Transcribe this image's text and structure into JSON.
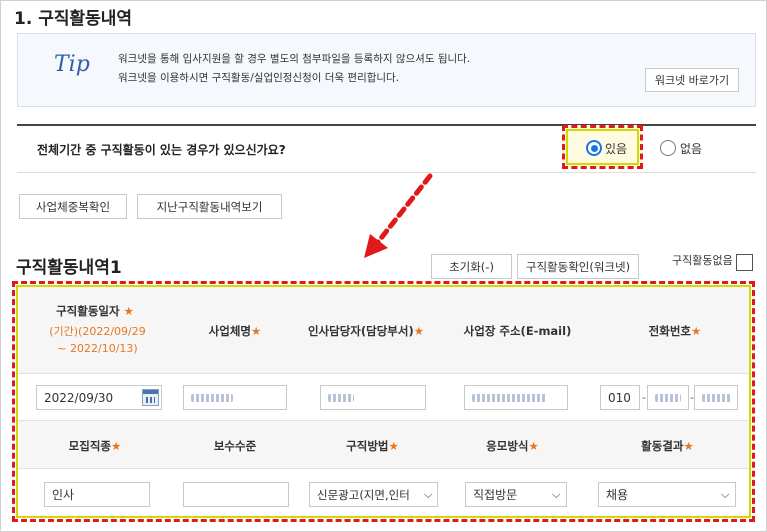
{
  "section": {
    "title": "1. 구직활동내역"
  },
  "tip": {
    "label": "Tip",
    "line1": "워크넷을 통해 입사지원을 할 경우 별도의 첨부파일을 등록하지 않으셔도 됩니다.",
    "line2": "워크넷을 이용하시면 구직활동/실업인정신청이 더욱 편리합니다.",
    "shortcut_button": "워크넷 바로가기"
  },
  "question": {
    "text": "전체기간 중 구직활동이 있는 경우가 있으신가요?",
    "options": [
      {
        "label": "있음",
        "selected": true
      },
      {
        "label": "없음",
        "selected": false
      }
    ]
  },
  "actions": {
    "duplicate_check": "사업체중복확인",
    "past_history": "지난구직활동내역보기"
  },
  "list": {
    "title": "구직활동내역1",
    "reset_button": "초기화(-)",
    "confirm_button": "구직활동확인(워크넷)",
    "no_activity_label": "구직활동없음",
    "no_activity_checked": false
  },
  "table": {
    "header1": {
      "date": "구직활동일자",
      "period": "(기간)(2022/09/29",
      "period2": "~ 2022/10/13)",
      "company": "사업체명",
      "manager": "인사담당자(담당부서)",
      "address": "사업장 주소(E-mail)",
      "phone": "전화번호"
    },
    "row1": {
      "date": "2022/09/30",
      "phone_prefix": "010"
    },
    "header2": {
      "job": "모집직종",
      "salary": "보수수준",
      "method": "구직방법",
      "apply": "응모방식",
      "result": "활동결과"
    },
    "row2": {
      "job": "인사",
      "salary": "",
      "method": "신문광고(지면,인터",
      "apply": "직접방문",
      "result": "채용"
    },
    "required_mark": "★"
  },
  "colors": {
    "highlight_dash": "#e0191a",
    "highlight_inner": "#d7d700",
    "accent_orange": "#e87722",
    "radio_blue": "#1a73e8"
  }
}
